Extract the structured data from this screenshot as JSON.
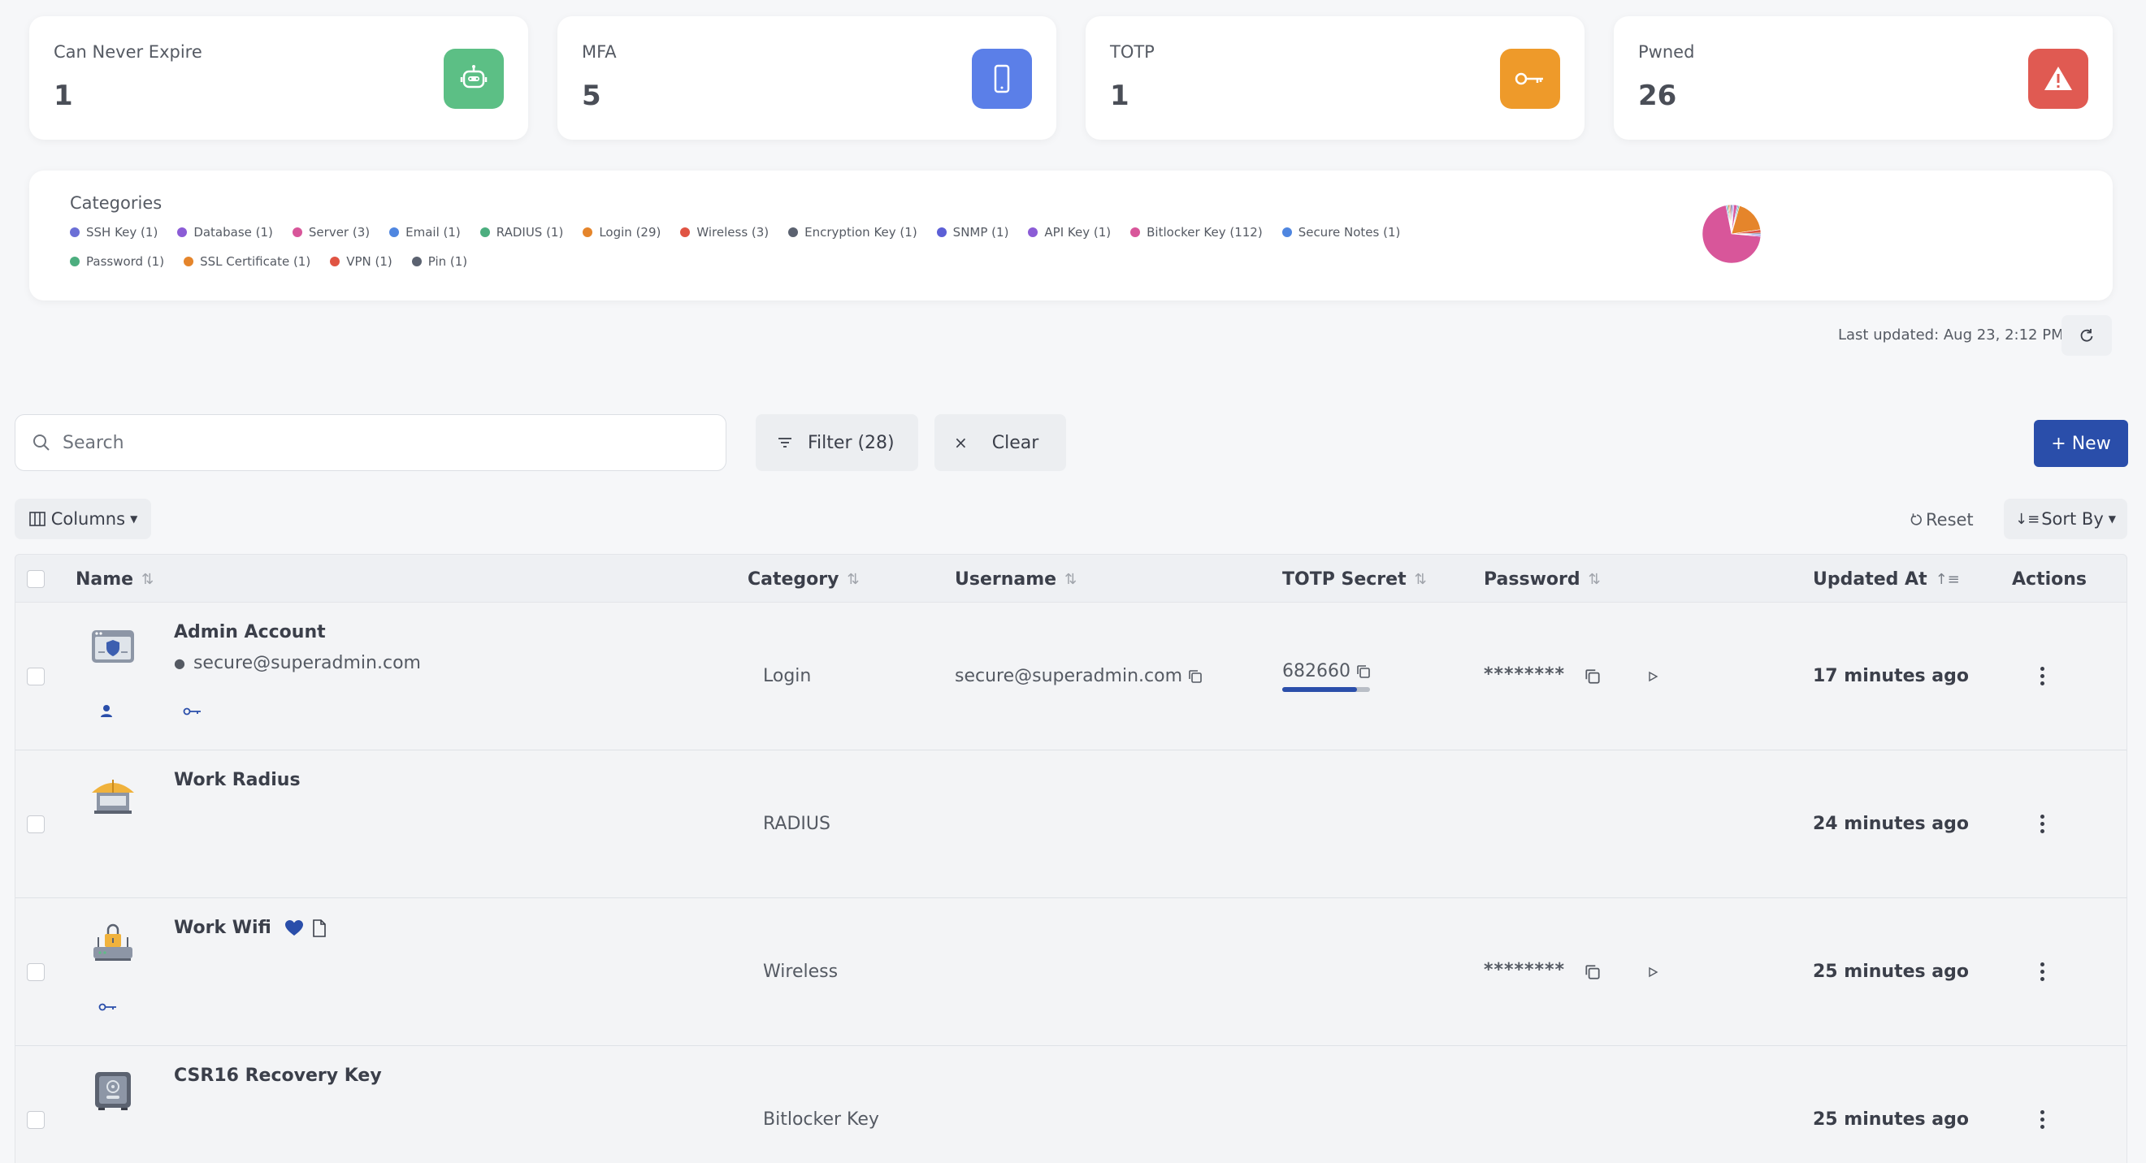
{
  "stats": [
    {
      "label": "Can Never Expire",
      "value": "1",
      "icon": "robot-icon",
      "color": "#5cbf85"
    },
    {
      "label": "MFA",
      "value": "5",
      "icon": "mobile-phone-icon",
      "color": "#5b7fe8"
    },
    {
      "label": "TOTP",
      "value": "1",
      "icon": "key-icon",
      "color": "#ee9a2a"
    },
    {
      "label": "Pwned",
      "value": "26",
      "icon": "warning-icon",
      "color": "#e05a52"
    }
  ],
  "categories": {
    "title": "Categories",
    "legend": [
      {
        "label": "SSH Key (1)",
        "color": "#6b6fd6"
      },
      {
        "label": "Database (1)",
        "color": "#8b5cd6"
      },
      {
        "label": "Server (3)",
        "color": "#d8569a"
      },
      {
        "label": "Email (1)",
        "color": "#4f86e0"
      },
      {
        "label": "RADIUS (1)",
        "color": "#4cae7f"
      },
      {
        "label": "Login (29)",
        "color": "#e5852b"
      },
      {
        "label": "Wireless (3)",
        "color": "#e05443"
      },
      {
        "label": "Encryption Key (1)",
        "color": "#5b6270"
      },
      {
        "label": "SNMP (1)",
        "color": "#5c5fd6"
      },
      {
        "label": "API Key (1)",
        "color": "#8b5cd6"
      },
      {
        "label": "Bitlocker Key (112)",
        "color": "#d8569a"
      },
      {
        "label": "Secure Notes (1)",
        "color": "#4f86e0"
      },
      {
        "label": "Password (1)",
        "color": "#4cae7f"
      },
      {
        "label": "SSL Certificate (1)",
        "color": "#e5852b"
      },
      {
        "label": "VPN (1)",
        "color": "#e05443"
      },
      {
        "label": "Pin (1)",
        "color": "#5b6270"
      }
    ]
  },
  "chart_data": {
    "type": "pie",
    "categories": [
      "SSH Key",
      "Database",
      "Server",
      "Email",
      "RADIUS",
      "Login",
      "Wireless",
      "Encryption Key",
      "SNMP",
      "API Key",
      "Bitlocker Key",
      "Secure Notes",
      "Password",
      "SSL Certificate",
      "VPN",
      "Pin"
    ],
    "values": [
      1,
      1,
      3,
      1,
      1,
      29,
      3,
      1,
      1,
      1,
      112,
      1,
      1,
      1,
      1,
      1
    ],
    "colors": [
      "#6b6fd6",
      "#8b5cd6",
      "#d8569a",
      "#4f86e0",
      "#4cae7f",
      "#e5852b",
      "#e05443",
      "#5b6270",
      "#5c5fd6",
      "#8b5cd6",
      "#d8569a",
      "#4f86e0",
      "#4cae7f",
      "#e5852b",
      "#e05443",
      "#5b6270"
    ]
  },
  "last_updated": "Last updated: Aug 23, 2:12 PM",
  "toolbar": {
    "search_placeholder": "Search",
    "filter_label": "Filter (28)",
    "clear_label": "Clear",
    "new_label": "+ New",
    "columns_label": "Columns",
    "reset_label": "Reset",
    "sort_label": "Sort By"
  },
  "table": {
    "headers": {
      "name": "Name",
      "category": "Category",
      "username": "Username",
      "totp": "TOTP Secret",
      "password": "Password",
      "updated": "Updated At",
      "actions": "Actions"
    },
    "rows": [
      {
        "name": "Admin Account",
        "sub": "secure@superadmin.com",
        "category": "Login",
        "username": "secure@superadmin.com",
        "totp": "682660",
        "totp_progress": 0.85,
        "password": "********",
        "updated": "17 minutes ago",
        "icon": "server-window-icon"
      },
      {
        "name": "Work Radius",
        "sub": "",
        "category": "RADIUS",
        "username": "",
        "totp": "",
        "password": "",
        "updated": "24 minutes ago",
        "icon": "radius-antenna-icon"
      },
      {
        "name": "Work Wifi",
        "sub": "",
        "category": "Wireless",
        "username": "",
        "totp": "",
        "password": "********",
        "updated": "25 minutes ago",
        "icon": "router-lock-icon"
      },
      {
        "name": "CSR16 Recovery Key",
        "sub": "",
        "category": "Bitlocker Key",
        "username": "",
        "totp": "",
        "password": "",
        "updated": "25 minutes ago",
        "icon": "safe-icon"
      }
    ]
  }
}
